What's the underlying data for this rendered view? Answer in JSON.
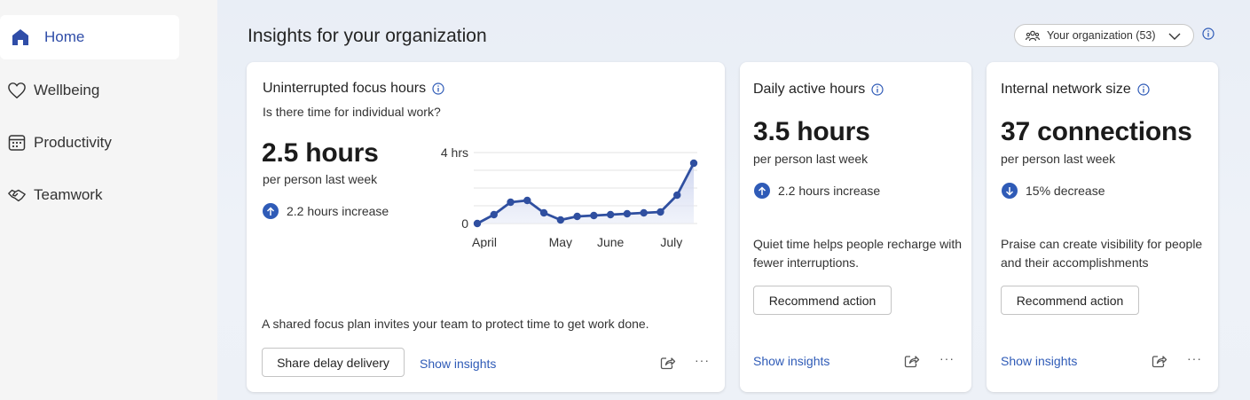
{
  "sidebar": {
    "items": [
      {
        "label": "Home",
        "icon": "home-icon",
        "active": true
      },
      {
        "label": "Wellbeing",
        "icon": "heart-icon",
        "active": false
      },
      {
        "label": "Productivity",
        "icon": "calendar-icon",
        "active": false
      },
      {
        "label": "Teamwork",
        "icon": "handshake-icon",
        "active": false
      }
    ]
  },
  "header": {
    "title": "Insights for your organization",
    "org_selector": "Your organization (53)"
  },
  "colors": {
    "accent": "#2f5bb7",
    "active_nav": "#2f4da8",
    "line": "#2f4fa0"
  },
  "cards": [
    {
      "title": "Uninterrupted focus hours",
      "subtitle": "Is there time for individual work?",
      "value": "2.5 hours",
      "period": "per person last week",
      "trend": "2.2 hours increase",
      "trend_direction": "up",
      "description": "A shared focus plan invites your team to protect time to get work done.",
      "button": "Share delay delivery",
      "link": "Show insights"
    },
    {
      "title": "Daily active hours",
      "value": "3.5 hours",
      "period": "per person last week",
      "trend": "2.2 hours increase",
      "trend_direction": "up",
      "description": "Quiet time helps people recharge with fewer interruptions.",
      "button": "Recommend action",
      "link": "Show insights"
    },
    {
      "title": "Internal network size",
      "value": "37 connections",
      "period": "per person last week",
      "trend": "15% decrease",
      "trend_direction": "down",
      "description": "Praise can create visibility for people and their accomplishments",
      "button": "Recommend action",
      "link": "Show insights"
    }
  ],
  "chart_data": {
    "type": "area",
    "x_labels": [
      "April",
      "May",
      "June",
      "July"
    ],
    "x_label_index": [
      0,
      5,
      8,
      12
    ],
    "y_ticks": [
      "4 hrs",
      "0"
    ],
    "ylim": [
      0,
      4
    ],
    "series": [
      {
        "values": [
          0.0,
          0.5,
          1.2,
          1.3,
          0.6,
          0.2,
          0.4,
          0.45,
          0.5,
          0.55,
          0.6,
          0.65,
          1.6,
          3.4
        ]
      }
    ],
    "grid": true
  }
}
